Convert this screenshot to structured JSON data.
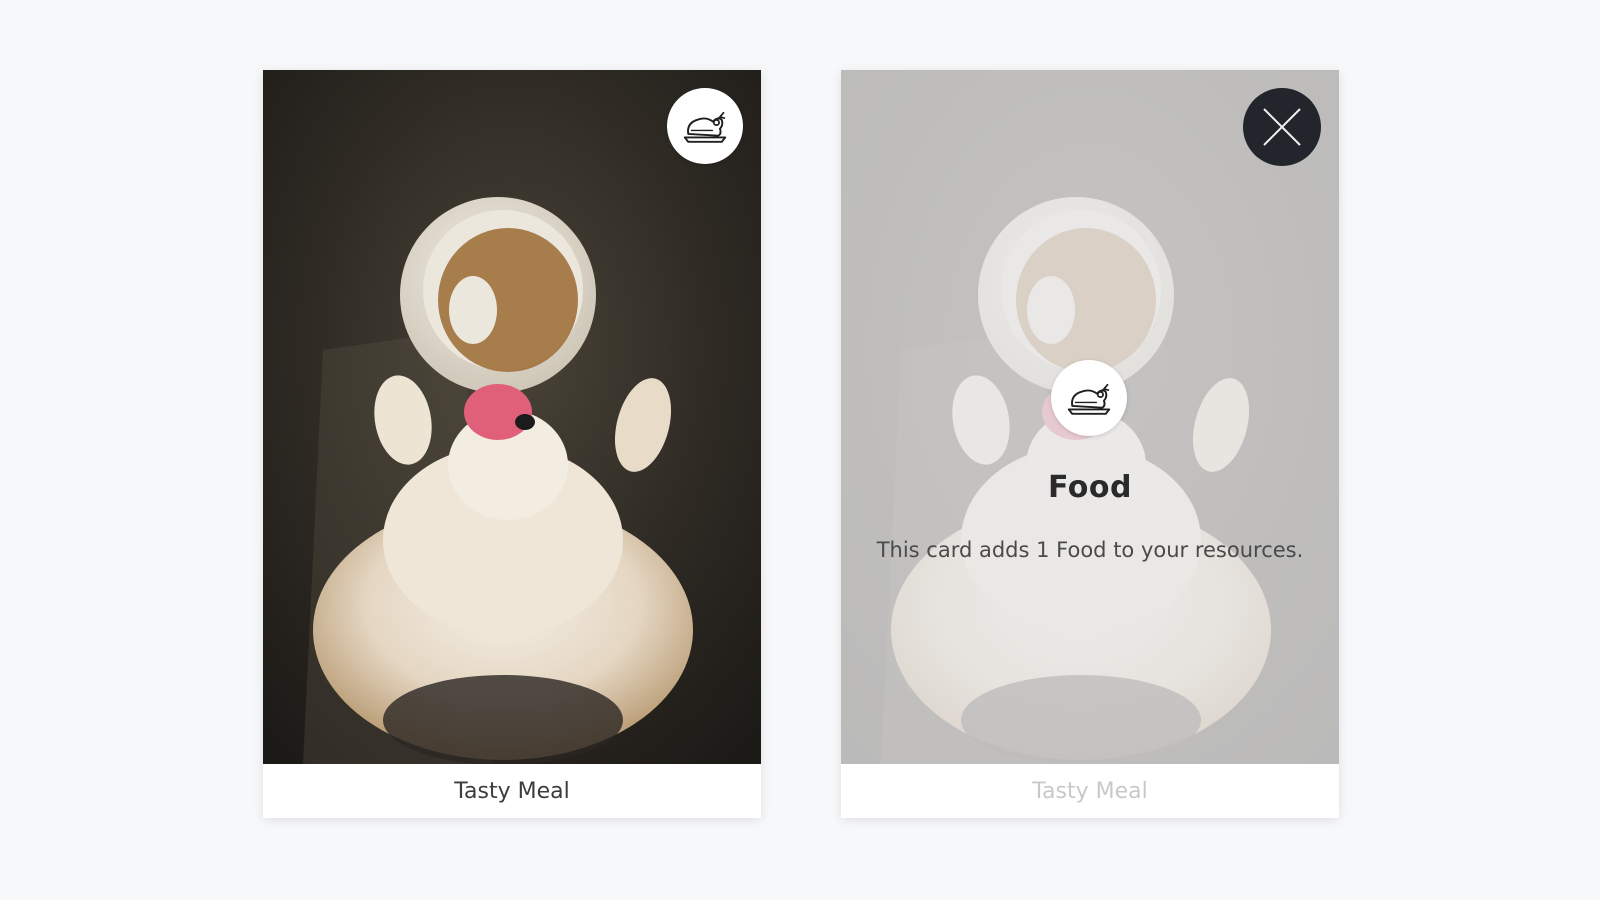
{
  "cards": [
    {
      "side": "front",
      "caption": "Tasty Meal",
      "icon": "food-icon"
    },
    {
      "side": "back",
      "caption": "Tasty Meal",
      "icon": "food-icon",
      "close_icon": "close-icon",
      "title": "Food",
      "description": "This card adds 1 Food to your resources."
    }
  ]
}
